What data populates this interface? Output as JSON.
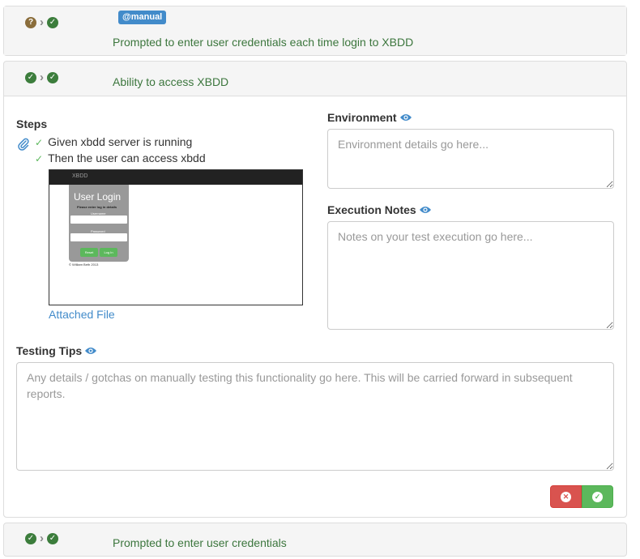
{
  "scenarios": [
    {
      "tag": "@manual",
      "title": "Prompted to enter user credentials each time login to XBDD",
      "status_icons": [
        "question-circle-icon",
        "chevron-right-icon",
        "check-circle-icon"
      ]
    },
    {
      "title": "Ability to access XBDD",
      "status_icons": [
        "check-circle-icon",
        "chevron-right-icon",
        "check-circle-icon"
      ],
      "steps_label": "Steps",
      "steps": [
        "Given xbdd server is running",
        "Then the user can access xbdd"
      ],
      "attachment": {
        "brand": "XBDD",
        "heading": "User Login",
        "subheading": "Please enter log in details",
        "username_label": "Username",
        "password_label": "Password",
        "reset_label": "Reset",
        "login_label": "Log In",
        "footer": "© William Beth 2013"
      },
      "attached_link": "Attached File",
      "environment": {
        "label": "Environment",
        "placeholder": "Environment details go here..."
      },
      "execution_notes": {
        "label": "Execution Notes",
        "placeholder": "Notes on your test execution go here..."
      },
      "testing_tips": {
        "label": "Testing Tips",
        "placeholder": "Any details / gotchas on manually testing this functionality go here. This will be carried forward in subsequent reports."
      },
      "buttons": [
        "fail-icon",
        "pass-icon"
      ]
    },
    {
      "title": "Prompted to enter user credentials",
      "status_icons": [
        "check-circle-icon",
        "chevron-right-icon",
        "check-circle-icon"
      ]
    }
  ],
  "colors": {
    "success": "#3c763d",
    "link": "#428bca",
    "danger": "#d9534f",
    "pass": "#5cb85c",
    "tag": "#428bca"
  }
}
